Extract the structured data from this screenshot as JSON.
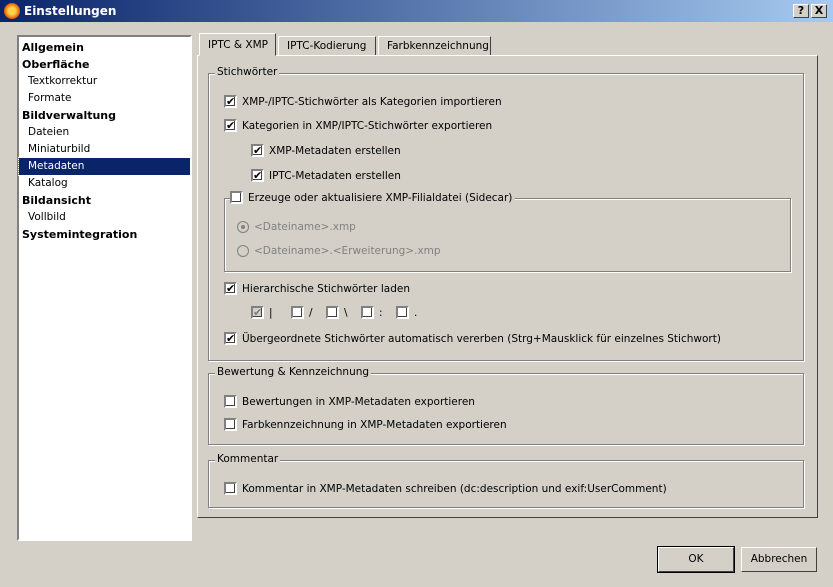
{
  "window": {
    "title": "Einstellungen",
    "help": "?",
    "close": "X"
  },
  "nav": [
    {
      "label": "Allgemein",
      "bold": true
    },
    {
      "label": "Oberfläche",
      "bold": true
    },
    {
      "label": "Textkorrektur"
    },
    {
      "label": "Formate"
    },
    {
      "label": "Bildverwaltung",
      "bold": true
    },
    {
      "label": "Dateien"
    },
    {
      "label": "Miniaturbild"
    },
    {
      "label": "Metadaten",
      "selected": true
    },
    {
      "label": "Katalog"
    },
    {
      "label": "Bildansicht",
      "bold": true
    },
    {
      "label": "Vollbild"
    },
    {
      "label": "Systemintegration",
      "bold": true
    }
  ],
  "tabs": [
    "IPTC & XMP",
    "IPTC-Kodierung",
    "Farbkennzeichnung"
  ],
  "stichwoerter": {
    "title": "Stichwörter",
    "import": {
      "label": "XMP-/IPTC-Stichwörter als Kategorien importieren",
      "checked": true
    },
    "export": {
      "label": "Kategorien in XMP/IPTC-Stichwörter exportieren",
      "checked": true
    },
    "xmp": {
      "label": "XMP-Metadaten erstellen",
      "checked": true
    },
    "iptc": {
      "label": "IPTC-Metadaten erstellen",
      "checked": true
    },
    "sidecar": {
      "label": "Erzeuge oder aktualisiere XMP-Filialdatei (Sidecar)",
      "checked": false,
      "opt1": "<Dateiname>.xmp",
      "opt2": "<Dateiname>.<Erweiterung>.xmp"
    },
    "hier": {
      "label": "Hierarchische Stichwörter laden",
      "checked": true
    },
    "separators": [
      "|",
      "/",
      "\\",
      ":",
      "."
    ],
    "inherit": {
      "label": "Übergeordnete Stichwörter automatisch vererben (Strg+Mausklick für einzelnes Stichwort)",
      "checked": true
    }
  },
  "bewertung": {
    "title": "Bewertung & Kennzeichnung",
    "ratings": "Bewertungen in XMP-Metadaten exportieren",
    "colors": "Farbkennzeichnung in XMP-Metadaten exportieren"
  },
  "kommentar": {
    "title": "Kommentar",
    "write": "Kommentar in XMP-Metadaten schreiben (dc:description und exif:UserComment)"
  },
  "buttons": {
    "ok": "OK",
    "cancel": "Abbrechen"
  },
  "check": "✔"
}
